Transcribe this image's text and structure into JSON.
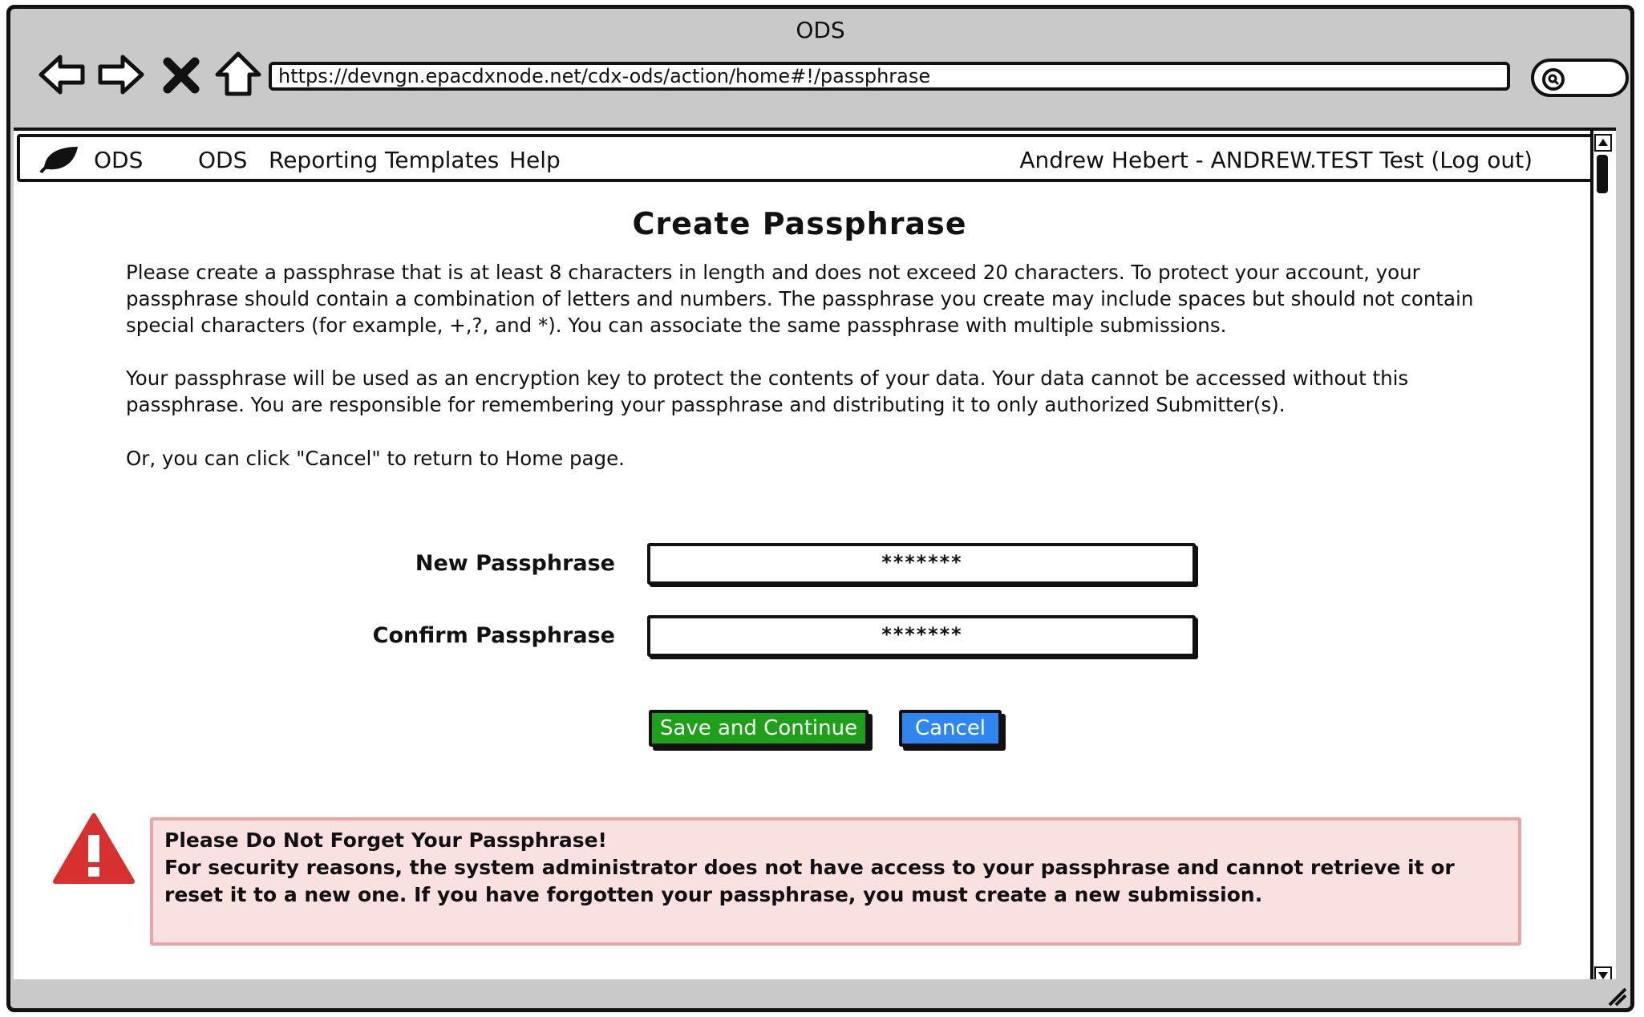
{
  "window": {
    "title": "ODS"
  },
  "browser": {
    "url": "https://devngn.epacdxnode.net/cdx-ods/action/home#!/passphrase",
    "buttons": [
      "back-icon",
      "forward-icon",
      "stop-icon",
      "home-icon"
    ]
  },
  "menubar": {
    "logo_label": "ODS",
    "items": [
      {
        "label": "ODS"
      },
      {
        "label": "Reporting Templates"
      },
      {
        "label": "Help"
      }
    ],
    "user": "Andrew Hebert - ANDREW.TEST Test (Log out)"
  },
  "page": {
    "title": "Create Passphrase",
    "paragraphs": [
      "Please create a passphrase that is at least 8 characters in length and does not exceed 20 characters. To protect your account, your passphrase should contain a combination of letters and numbers. The passphrase you create may include spaces but should not contain special characters (for example, +,?, and *). You can associate the same passphrase with multiple submissions.",
      "Your passphrase will be used as an encryption key to protect the contents of your data. Your data cannot be accessed without this passphrase. You are responsible for remembering your passphrase and distributing it to only authorized Submitter(s).",
      "Or, you can click \"Cancel\" to return to Home page."
    ]
  },
  "form": {
    "new_label": "New Passphrase",
    "new_value": "*******",
    "confirm_label": "Confirm Passphrase",
    "confirm_value": "*******",
    "save_label": "Save and Continue",
    "cancel_label": "Cancel"
  },
  "alert": {
    "heading": "Please Do Not Forget Your Passphrase!",
    "body": "For security reasons, the system administrator does not have access to your passphrase and cannot retrieve it or reset it to a new one. If you have forgotten your passphrase, you must create a new submission."
  },
  "colors": {
    "save_button": "#1fa01a",
    "cancel_button": "#2f86f0",
    "alert_icon": "#d7312f",
    "alert_bg": "#f9e1e2",
    "alert_border": "#e8a4a7"
  }
}
